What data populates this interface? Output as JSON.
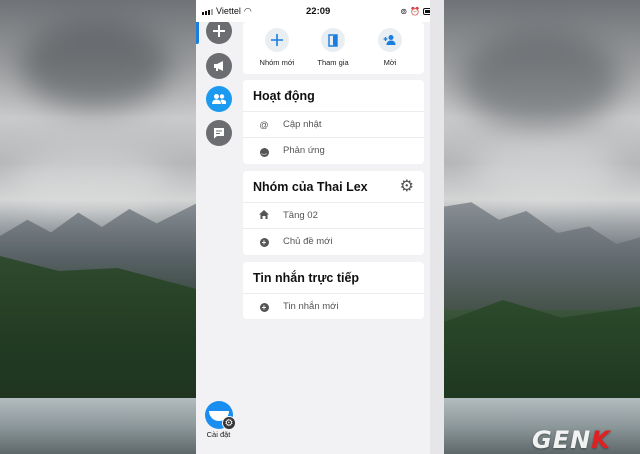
{
  "status_bar": {
    "carrier": "Viettel",
    "time": "22:09"
  },
  "sidebar": {
    "items": [
      {
        "name": "add",
        "icon": "plus-icon",
        "active": false
      },
      {
        "name": "announcements",
        "icon": "megaphone-icon",
        "active": false
      },
      {
        "name": "groups",
        "icon": "people-icon",
        "active": true
      },
      {
        "name": "messages",
        "icon": "chat-icon",
        "active": false
      }
    ],
    "settings_label": "Cài đặt"
  },
  "actions": [
    {
      "label": "Nhóm mới",
      "icon": "plus-icon"
    },
    {
      "label": "Tham gia",
      "icon": "door-icon"
    },
    {
      "label": "Mời",
      "icon": "add-person-icon"
    }
  ],
  "activity": {
    "title": "Hoạt động",
    "items": [
      {
        "label": "Cập nhật",
        "icon": "at-icon"
      },
      {
        "label": "Phản ứng",
        "icon": "smiley-icon"
      }
    ]
  },
  "group": {
    "title": "Nhóm của Thai Lex",
    "items": [
      {
        "label": "Tầng 02",
        "icon": "home-icon"
      },
      {
        "label": "Chủ đề mới",
        "icon": "plus-circle-icon"
      }
    ]
  },
  "direct": {
    "title": "Tin nhắn trực tiếp",
    "items": [
      {
        "label": "Tin nhắn mới",
        "icon": "plus-circle-icon"
      }
    ]
  },
  "colors": {
    "accent": "#1a7de0",
    "active_sidebar": "#1c9af0",
    "sidebar_icon_bg": "#6b6d70"
  },
  "watermark": {
    "text_main": "GEN",
    "text_accent": "K"
  }
}
